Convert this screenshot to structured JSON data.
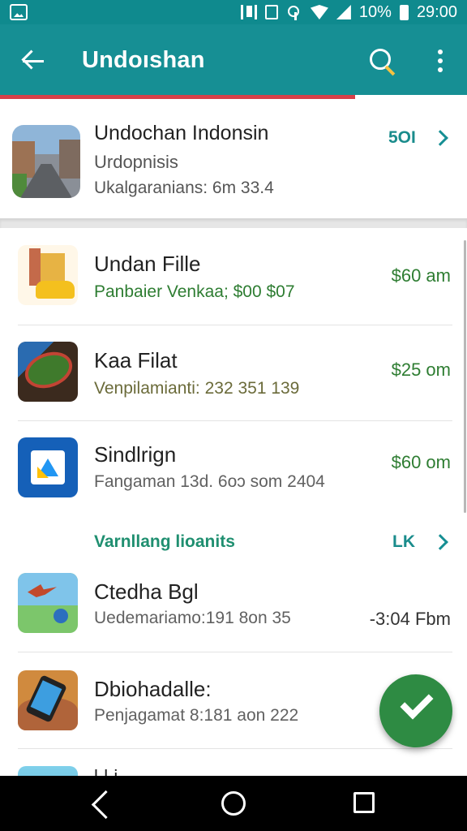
{
  "status_bar": {
    "battery": "10%",
    "time": "29:00"
  },
  "app_bar": {
    "title": "Undoıshan",
    "progress": 0.76
  },
  "top_card": {
    "title": "Undochan Indonsin",
    "subtitle": "Urdopnisis",
    "meta": "Ukalgaranians: 6m 33.4",
    "value": "5OI"
  },
  "list": [
    {
      "title": "Undan Fille",
      "subtitle": "Panbaier Venkaa; $00 $07",
      "amount": "$60 am",
      "icon": "building-car-icon"
    },
    {
      "title": "Kaa Filat",
      "subtitle": "Venpilamianti: 232 351 139",
      "amount": "$25 om",
      "icon": "leaf-icon"
    },
    {
      "title": "Sindlrign",
      "subtitle": "Fangaman 13d. 6oɔ som 2404",
      "amount": "$60 om",
      "icon": "docs-icon"
    }
  ],
  "group": {
    "header": "Varnllang lioanits",
    "link": "LK"
  },
  "list2": [
    {
      "title": "Ctedha Bgl",
      "subtitle": "Uedemariamo:191 8on 35",
      "amount": "-3:04 Fbm",
      "icon": "birds-icon"
    },
    {
      "title": "Dbiohadalle:",
      "subtitle": "Penjagamat 8:181 aon 222",
      "amount": "",
      "icon": "phone-icon"
    }
  ],
  "partial_row": {
    "title": "l·l·i"
  }
}
